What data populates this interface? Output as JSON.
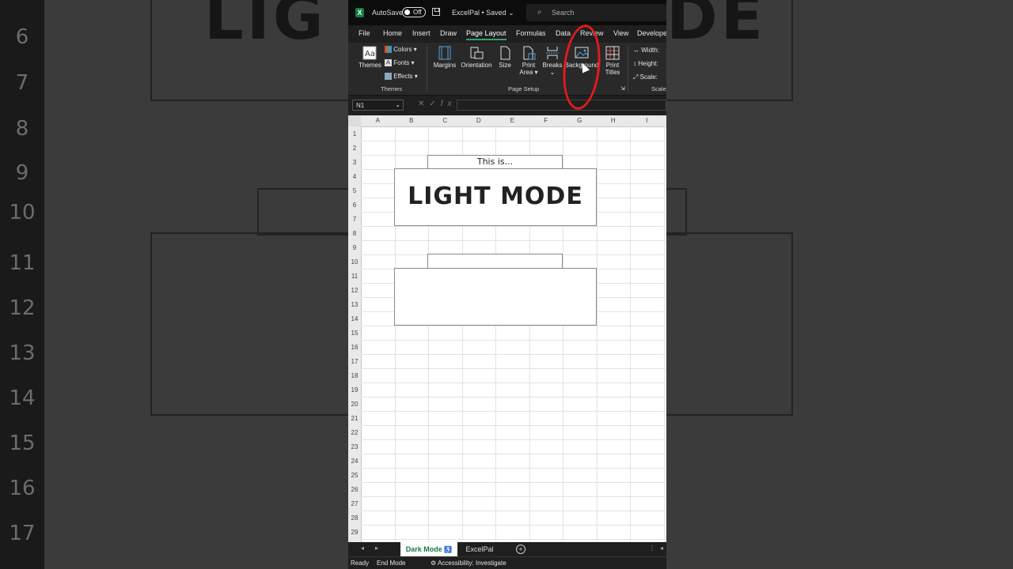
{
  "background": {
    "row_numbers": [
      "6",
      "7",
      "8",
      "9",
      "10",
      "11",
      "12",
      "13",
      "14",
      "15",
      "16",
      "17"
    ]
  },
  "titlebar": {
    "autosave_label": "AutoSave",
    "autosave_state": "Off",
    "filename": "ExcelPal • Saved ⌄",
    "search_placeholder": "Search"
  },
  "tabs": [
    {
      "label": "File"
    },
    {
      "label": "Home"
    },
    {
      "label": "Insert"
    },
    {
      "label": "Draw"
    },
    {
      "label": "Page Layout",
      "active": true
    },
    {
      "label": "Formulas"
    },
    {
      "label": "Data"
    },
    {
      "label": "Review"
    },
    {
      "label": "View"
    },
    {
      "label": "Develope"
    }
  ],
  "ribbon": {
    "themes": {
      "themes_label": "Themes",
      "colors_label": "Colors ▾",
      "fonts_label": "Fonts ▾",
      "effects_label": "Effects ▾",
      "group_label": "Themes"
    },
    "page_setup": {
      "margins_label": "Margins",
      "orientation_label": "Orientation",
      "size_label": "Size",
      "print_area_label_1": "Print",
      "print_area_label_2": "Area ▾",
      "breaks_label": "Breaks",
      "background_label": "Background",
      "print_titles_label_1": "Print",
      "print_titles_label_2": "Titles",
      "group_label": "Page Setup"
    },
    "scale": {
      "width_label": "Width:",
      "height_label": "Height:",
      "scale_label": "Scale:",
      "group_label": "Scale"
    }
  },
  "formula_bar": {
    "name_box": "N1",
    "formula": ""
  },
  "grid": {
    "columns": [
      "A",
      "B",
      "C",
      "D",
      "E",
      "F",
      "G",
      "H",
      "I"
    ],
    "rows": [
      "1",
      "2",
      "3",
      "4",
      "5",
      "6",
      "7",
      "8",
      "9",
      "10",
      "11",
      "12",
      "13",
      "14",
      "15",
      "16",
      "17",
      "18",
      "19",
      "20",
      "21",
      "22",
      "23",
      "24",
      "25",
      "26",
      "27",
      "28",
      "29"
    ],
    "box1_caption": "This is...",
    "box1_title": "LIGHT MODE",
    "box2_caption": "",
    "box2_title": ""
  },
  "sheets": [
    {
      "label": "Dark Mode",
      "active": true
    },
    {
      "label": "ExcelPal",
      "active": false
    }
  ],
  "status": {
    "ready": "Ready",
    "end_mode": "End Mode",
    "accessibility": "Accessibility: Investigate"
  },
  "colors": {
    "excel_green": "#107c41",
    "annotation_red": "#e11b1b",
    "active_tab_underline": "#2fa36b"
  }
}
